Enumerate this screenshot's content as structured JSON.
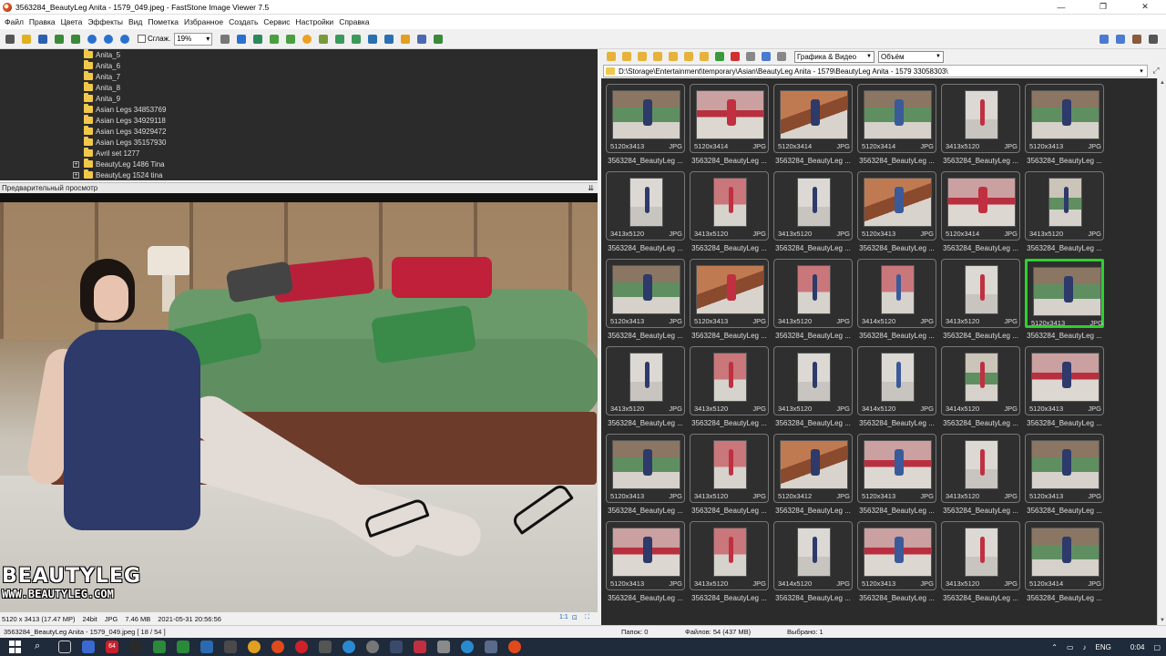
{
  "window": {
    "title": "3563284_BeautyLeg Anita - 1579_049.jpeg  -  FastStone Image Viewer 7.5",
    "minimize": "—",
    "maximize": "❐",
    "close": "✕"
  },
  "menu": [
    "Файл",
    "Правка",
    "Цвета",
    "Эффекты",
    "Вид",
    "Пометка",
    "Избранное",
    "Создать",
    "Сервис",
    "Настройки",
    "Справка"
  ],
  "toolbar": {
    "smooth_label": "Сглаж.",
    "zoom_value": "19%"
  },
  "tree": {
    "items": [
      {
        "label": "Anita_5",
        "expandable": false
      },
      {
        "label": "Anita_6",
        "expandable": false
      },
      {
        "label": "Anita_7",
        "expandable": false
      },
      {
        "label": "Anita_8",
        "expandable": false
      },
      {
        "label": "Anita_9",
        "expandable": false
      },
      {
        "label": "Asian Legs 34853769",
        "expandable": false
      },
      {
        "label": "Asian Legs 34929118",
        "expandable": false
      },
      {
        "label": "Asian Legs 34929472",
        "expandable": false
      },
      {
        "label": "Asian Legs 35157930",
        "expandable": false
      },
      {
        "label": "Avril set 1277",
        "expandable": false
      },
      {
        "label": "BeautyLeg 1486 Tina",
        "expandable": true
      },
      {
        "label": "BeautyLeg 1524 tina",
        "expandable": true
      }
    ],
    "expander_glyph": "+"
  },
  "preview": {
    "header": "Предварительный просмотр",
    "collapse_glyph": "⇊",
    "watermark_brand": "BEAUTYLEG",
    "watermark_url": "WWW.BEAUTYLEG.COM"
  },
  "image_info": {
    "dimensions": "5120 x 3413 (17.47 MP)",
    "bits": "24bit",
    "format": "JPG",
    "size": "7.46 MB",
    "date": "2021-05-31 20:56:56",
    "ratio_label": "1:1"
  },
  "browser": {
    "filter_value": "Графика & Видео",
    "sort_value": "Объём",
    "path": "D:\\Storage\\Entertainment\\temporary\\Asian\\BeautyLeg Anita - 1579\\BeautyLeg Anita - 1579 33058303\\"
  },
  "thumbnails": [
    {
      "dims": "5120x3413",
      "fmt": "JPG",
      "name": "3563284_BeautyLeg ...",
      "style": "land-green",
      "selected": false
    },
    {
      "dims": "5120x3414",
      "fmt": "JPG",
      "name": "3563284_BeautyLeg ...",
      "style": "land-red",
      "selected": false
    },
    {
      "dims": "5120x3414",
      "fmt": "JPG",
      "name": "3563284_BeautyLeg ...",
      "style": "land-wood",
      "selected": false
    },
    {
      "dims": "5120x3414",
      "fmt": "JPG",
      "name": "3563284_BeautyLeg ...",
      "style": "land-green",
      "selected": false
    },
    {
      "dims": "3413x5120",
      "fmt": "JPG",
      "name": "3563284_BeautyLeg ...",
      "style": "port-light",
      "selected": false
    },
    {
      "dims": "5120x3413",
      "fmt": "JPG",
      "name": "3563284_BeautyLeg ...",
      "style": "land-green",
      "selected": false
    },
    {
      "dims": "3413x5120",
      "fmt": "JPG",
      "name": "3563284_BeautyLeg ...",
      "style": "port-light",
      "selected": false
    },
    {
      "dims": "3413x5120",
      "fmt": "JPG",
      "name": "3563284_BeautyLeg ...",
      "style": "port-red",
      "selected": false
    },
    {
      "dims": "3413x5120",
      "fmt": "JPG",
      "name": "3563284_BeautyLeg ...",
      "style": "port-light",
      "selected": false
    },
    {
      "dims": "5120x3413",
      "fmt": "JPG",
      "name": "3563284_BeautyLeg ...",
      "style": "land-wood",
      "selected": false
    },
    {
      "dims": "5120x3414",
      "fmt": "JPG",
      "name": "3563284_BeautyLeg ...",
      "style": "land-red",
      "selected": false
    },
    {
      "dims": "3413x5120",
      "fmt": "JPG",
      "name": "3563284_BeautyLeg ...",
      "style": "port-green",
      "selected": false
    },
    {
      "dims": "5120x3413",
      "fmt": "JPG",
      "name": "3563284_BeautyLeg ...",
      "style": "land-green",
      "selected": false
    },
    {
      "dims": "5120x3413",
      "fmt": "JPG",
      "name": "3563284_BeautyLeg ...",
      "style": "land-wood",
      "selected": false
    },
    {
      "dims": "3413x5120",
      "fmt": "JPG",
      "name": "3563284_BeautyLeg ...",
      "style": "port-red",
      "selected": false
    },
    {
      "dims": "3414x5120",
      "fmt": "JPG",
      "name": "3563284_BeautyLeg ...",
      "style": "port-red",
      "selected": false
    },
    {
      "dims": "3413x5120",
      "fmt": "JPG",
      "name": "3563284_BeautyLeg ...",
      "style": "port-light",
      "selected": false
    },
    {
      "dims": "5120x3413",
      "fmt": "JPG",
      "name": "3563284_BeautyLeg ...",
      "style": "land-green",
      "selected": true
    },
    {
      "dims": "3413x5120",
      "fmt": "JPG",
      "name": "3563284_BeautyLeg ...",
      "style": "port-light",
      "selected": false
    },
    {
      "dims": "3413x5120",
      "fmt": "JPG",
      "name": "3563284_BeautyLeg ...",
      "style": "port-red",
      "selected": false
    },
    {
      "dims": "3413x5120",
      "fmt": "JPG",
      "name": "3563284_BeautyLeg ...",
      "style": "port-light",
      "selected": false
    },
    {
      "dims": "3414x5120",
      "fmt": "JPG",
      "name": "3563284_BeautyLeg ...",
      "style": "port-light",
      "selected": false
    },
    {
      "dims": "3414x5120",
      "fmt": "JPG",
      "name": "3563284_BeautyLeg ...",
      "style": "port-green",
      "selected": false
    },
    {
      "dims": "5120x3413",
      "fmt": "JPG",
      "name": "3563284_BeautyLeg ...",
      "style": "land-red",
      "selected": false
    },
    {
      "dims": "5120x3413",
      "fmt": "JPG",
      "name": "3563284_BeautyLeg ...",
      "style": "land-green",
      "selected": false
    },
    {
      "dims": "3413x5120",
      "fmt": "JPG",
      "name": "3563284_BeautyLeg ...",
      "style": "port-red",
      "selected": false
    },
    {
      "dims": "5120x3412",
      "fmt": "JPG",
      "name": "3563284_BeautyLeg ...",
      "style": "land-wood",
      "selected": false
    },
    {
      "dims": "5120x3413",
      "fmt": "JPG",
      "name": "3563284_BeautyLeg ...",
      "style": "land-red",
      "selected": false
    },
    {
      "dims": "3413x5120",
      "fmt": "JPG",
      "name": "3563284_BeautyLeg ...",
      "style": "port-light",
      "selected": false
    },
    {
      "dims": "5120x3413",
      "fmt": "JPG",
      "name": "3563284_BeautyLeg ...",
      "style": "land-green",
      "selected": false
    },
    {
      "dims": "5120x3413",
      "fmt": "JPG",
      "name": "3563284_BeautyLeg ...",
      "style": "land-red",
      "selected": false
    },
    {
      "dims": "3413x5120",
      "fmt": "JPG",
      "name": "3563284_BeautyLeg ...",
      "style": "port-red",
      "selected": false
    },
    {
      "dims": "3414x5120",
      "fmt": "JPG",
      "name": "3563284_BeautyLeg ...",
      "style": "port-light",
      "selected": false
    },
    {
      "dims": "5120x3413",
      "fmt": "JPG",
      "name": "3563284_BeautyLeg ...",
      "style": "land-red",
      "selected": false
    },
    {
      "dims": "3413x5120",
      "fmt": "JPG",
      "name": "3563284_BeautyLeg ...",
      "style": "port-light",
      "selected": false
    },
    {
      "dims": "5120x3414",
      "fmt": "JPG",
      "name": "3563284_BeautyLeg ...",
      "style": "land-green",
      "selected": false
    }
  ],
  "status": {
    "file": "3563284_BeautyLeg Anita - 1579_049.jpeg [ 18 / 54 ]",
    "folders": "Папок: 0",
    "files": "Файлов: 54 (437 MB)",
    "selected": "Выбрано: 1"
  },
  "taskbar": {
    "badge": "64",
    "lang": "ENG",
    "time": "0:04"
  },
  "colors": {
    "selection": "#2fcf2f",
    "panel_dark": "#2b2b2b",
    "taskbar": "#1f2a3a",
    "folder": "#f2c84b"
  }
}
